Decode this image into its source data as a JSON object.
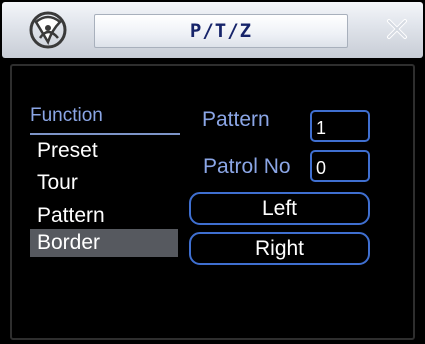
{
  "window": {
    "title": "P/T/Z"
  },
  "icons": {
    "logo": "dahua-logo-icon",
    "close": "close-icon"
  },
  "menu": {
    "header": "Function",
    "items": [
      {
        "label": "Preset",
        "selected": false
      },
      {
        "label": "Tour",
        "selected": false
      },
      {
        "label": "Pattern",
        "selected": false
      },
      {
        "label": "Border",
        "selected": true
      }
    ]
  },
  "form": {
    "pattern_label": "Pattern",
    "pattern_value": "1",
    "patrol_label": "Patrol No",
    "patrol_value": "0"
  },
  "buttons": {
    "left": "Left",
    "right": "Right"
  },
  "colors": {
    "accent_border": "#3f6fd0",
    "label_blue": "#8ba6e6",
    "title_text": "#16246a",
    "selected_bg": "#56595f"
  }
}
